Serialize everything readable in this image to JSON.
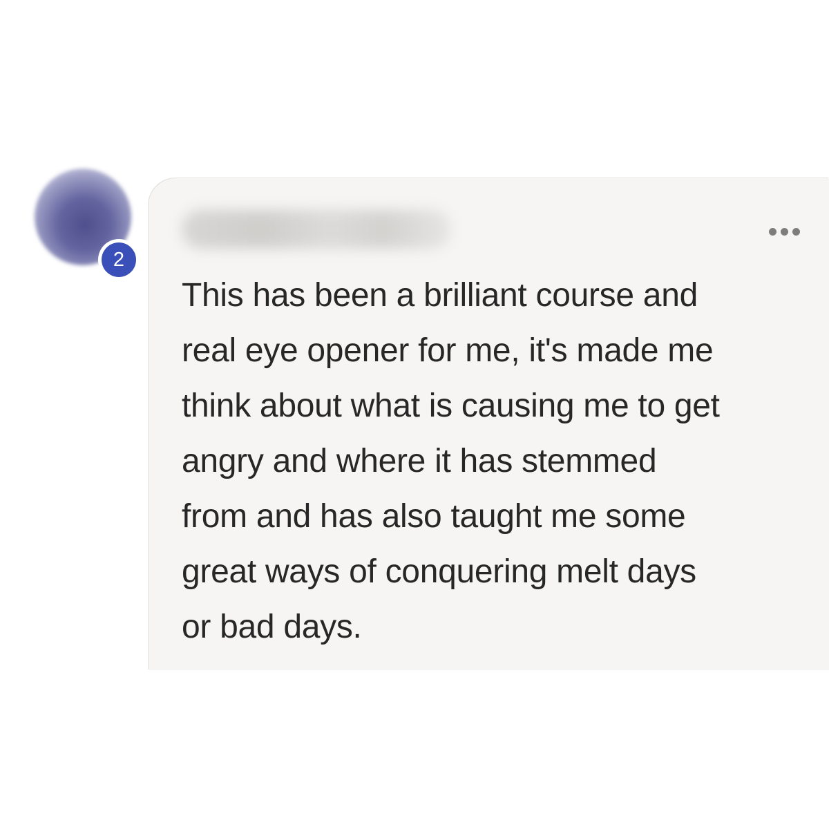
{
  "comment": {
    "avatar_badge": "2",
    "more_icon": "more-horizontal-icon",
    "lines": [
      "This has been a brilliant course and",
      "real eye opener for me, it's made me",
      "think about what is causing me to get",
      "angry and where it has stemmed",
      "from and has also taught me some",
      "great ways of conquering melt days",
      "or bad days."
    ]
  },
  "colors": {
    "badge": "#3b4fb8",
    "bubble": "#f6f5f3",
    "text": "#272727"
  }
}
